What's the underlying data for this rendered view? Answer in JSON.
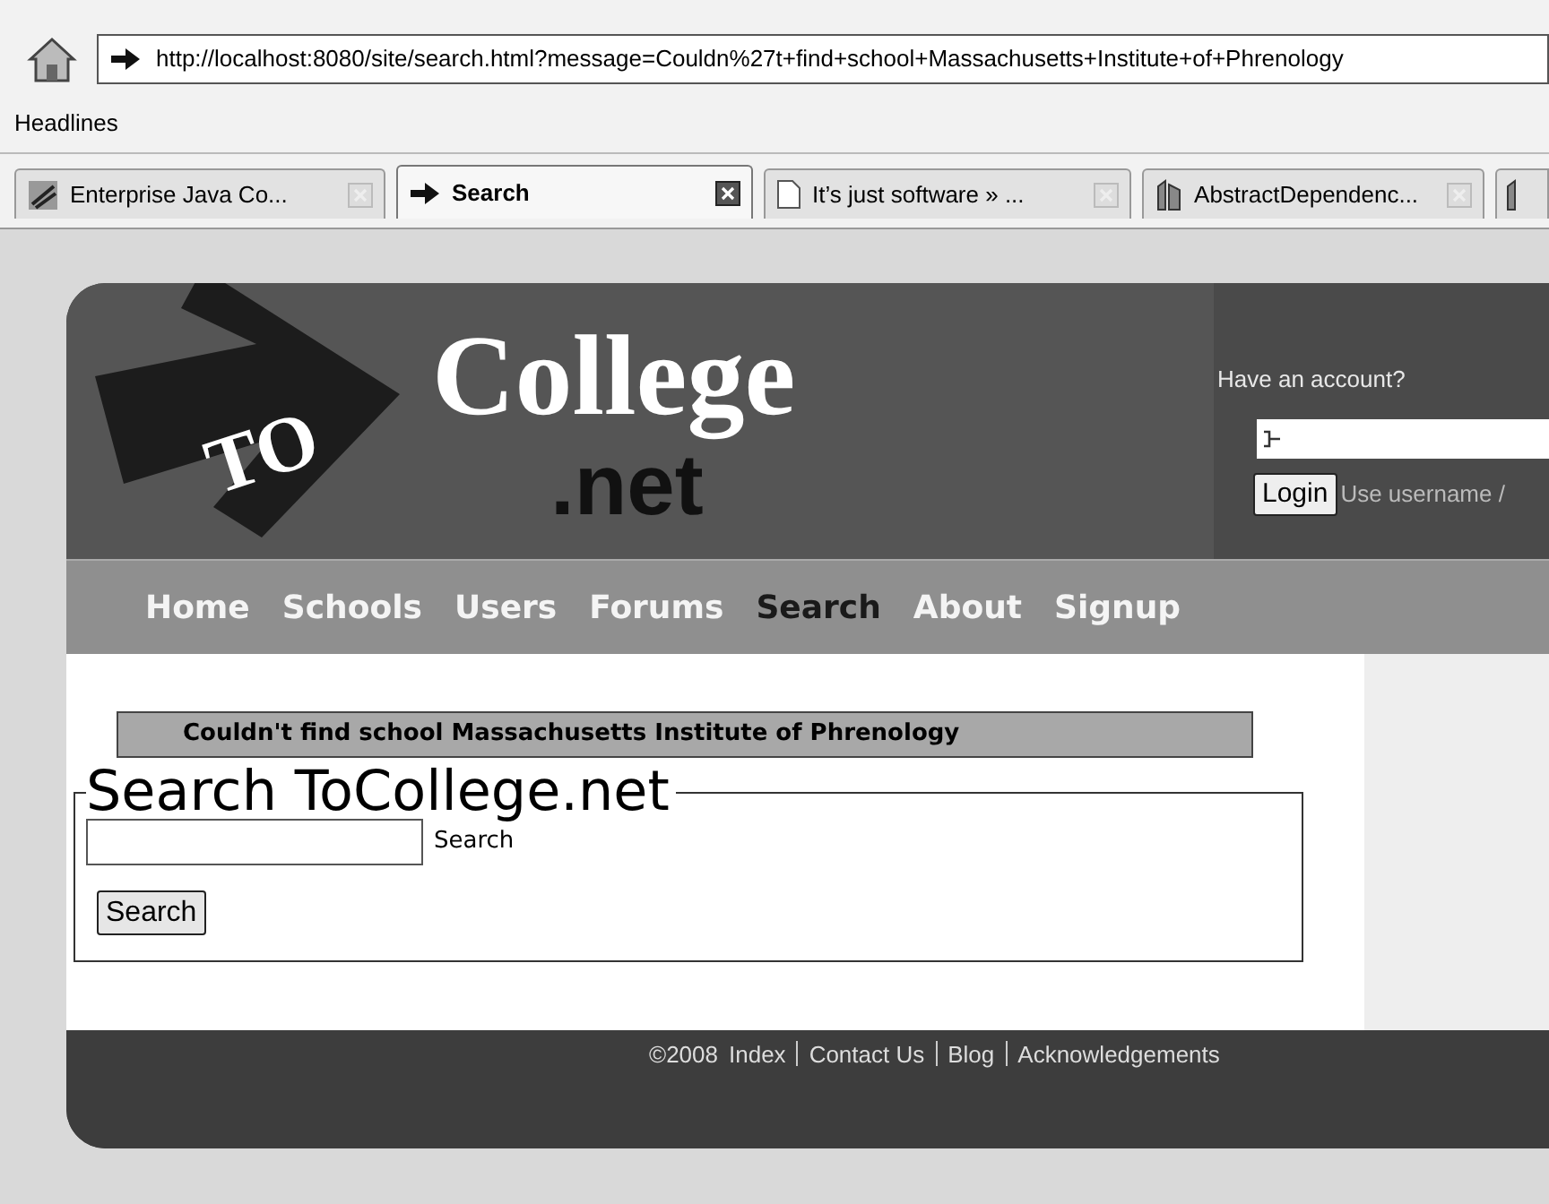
{
  "browser": {
    "address": "http://localhost:8080/site/search.html?message=Couldn%27t+find+school+Massachusetts+Institute+of+Phrenology",
    "bookmarks": [
      "Headlines"
    ],
    "tabs": [
      {
        "title": "Enterprise Java Co...",
        "selected": false,
        "kind": "java"
      },
      {
        "title": "Search",
        "selected": true,
        "kind": "site"
      },
      {
        "title": "It’s just software » ...",
        "selected": false,
        "kind": "page"
      },
      {
        "title": "AbstractDependenc...",
        "selected": false,
        "kind": "doc"
      }
    ]
  },
  "site": {
    "logo": {
      "badge": "TO",
      "name": "College",
      "suffix": ".net"
    },
    "login": {
      "prompt": "Have an account?",
      "button": "Login",
      "hint": "Use username /"
    },
    "nav": [
      {
        "label": "Home",
        "selected": false
      },
      {
        "label": "Schools",
        "selected": false
      },
      {
        "label": "Users",
        "selected": false
      },
      {
        "label": "Forums",
        "selected": false
      },
      {
        "label": "Search",
        "selected": true
      },
      {
        "label": "About",
        "selected": false
      },
      {
        "label": "Signup",
        "selected": false
      }
    ],
    "message": "Couldn't find school Massachusetts Institute of Phrenology",
    "search": {
      "legend": "Search ToCollege.net",
      "field_label": "Search",
      "button": "Search"
    },
    "footer": {
      "copyright": "©2008",
      "links": [
        "Index",
        "Contact Us",
        "Blog",
        "Acknowledgements"
      ]
    }
  }
}
